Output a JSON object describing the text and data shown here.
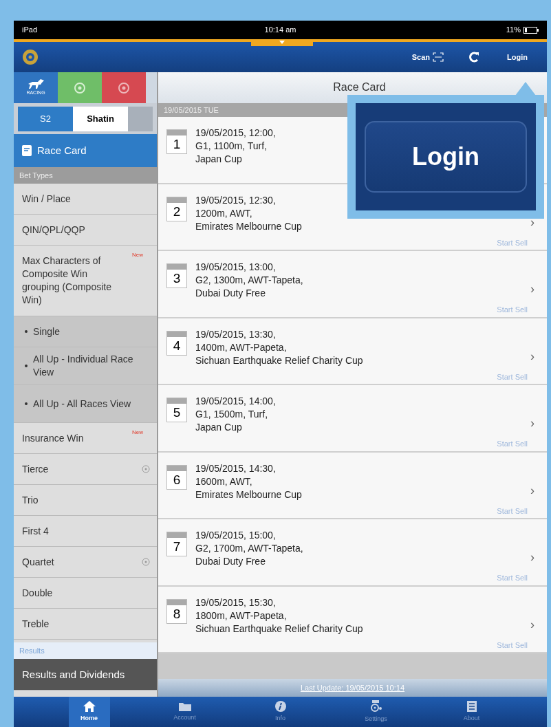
{
  "status_bar": {
    "carrier": "iPad",
    "time": "10:14 am",
    "battery": "11%"
  },
  "header": {
    "scan": "Scan",
    "login": "Login"
  },
  "sport_tabs": [
    {
      "kind": "racing",
      "label": "RACING",
      "selected": true
    },
    {
      "kind": "football",
      "selected": false
    },
    {
      "kind": "lottery",
      "selected": false
    }
  ],
  "venue_tabs": [
    {
      "label": "S2",
      "selected": true
    },
    {
      "label": "Shatin",
      "selected": false
    }
  ],
  "sidebar": {
    "race_card": {
      "label": "Race Card",
      "selected": true
    },
    "sections": [
      {
        "title": "Bet Types",
        "items": [
          {
            "kind": "item",
            "label": "Win / Place"
          },
          {
            "kind": "item",
            "label": "QIN/QPL/QQP"
          },
          {
            "kind": "item",
            "label": "Max Characters of Composite Win grouping (Composite Win)",
            "badge": "New"
          },
          {
            "kind": "sub",
            "label": "Single"
          },
          {
            "kind": "sub",
            "label": "All Up - Individual Race View"
          },
          {
            "kind": "sub",
            "label": "All Up - All Races View"
          },
          {
            "kind": "item",
            "label": "Insurance Win",
            "badge": "New"
          },
          {
            "kind": "item",
            "label": "Tierce",
            "expandable": true
          },
          {
            "kind": "item",
            "label": "Trio"
          },
          {
            "kind": "item",
            "label": "First 4"
          },
          {
            "kind": "item",
            "label": "Quartet",
            "expandable": true
          },
          {
            "kind": "item",
            "label": "Double"
          },
          {
            "kind": "item",
            "label": "Treble"
          }
        ]
      },
      {
        "title": "Results",
        "items": [
          {
            "kind": "dark",
            "label": "Results and Dividends"
          }
        ]
      }
    ]
  },
  "content": {
    "title": "Race Card",
    "date": "19/05/2015 TUE",
    "races": [
      {
        "number": "1",
        "lines": [
          "19/05/2015, 12:00,",
          "G1, 1100m, Turf,",
          "Japan Cup"
        ]
      },
      {
        "number": "2",
        "lines": [
          "19/05/2015, 12:30,",
          "1200m, AWT,",
          "Emirates Melbourne Cup"
        ],
        "chevron": "›",
        "start_sell": "Start Sell"
      },
      {
        "number": "3",
        "lines": [
          "19/05/2015, 13:00,",
          "G2, 1300m, AWT-Tapeta,",
          "Dubai Duty Free"
        ],
        "chevron": "›",
        "start_sell": "Start Sell"
      },
      {
        "number": "4",
        "lines": [
          "19/05/2015, 13:30,",
          "1400m, AWT-Papeta,",
          "Sichuan Earthquake Relief Charity Cup"
        ],
        "chevron": "›",
        "start_sell": "Start Sell"
      },
      {
        "number": "5",
        "lines": [
          "19/05/2015, 14:00,",
          "G1, 1500m, Turf,",
          "Japan Cup"
        ],
        "chevron": "›",
        "start_sell": "Start Sell"
      },
      {
        "number": "6",
        "lines": [
          "19/05/2015, 14:30,",
          "1600m, AWT,",
          "Emirates Melbourne Cup"
        ],
        "chevron": "›",
        "start_sell": "Start Sell"
      },
      {
        "number": "7",
        "lines": [
          "19/05/2015, 15:00,",
          "G2, 1700m, AWT-Tapeta,",
          "Dubai Duty Free"
        ],
        "chevron": "›",
        "start_sell": "Start Sell"
      },
      {
        "number": "8",
        "lines": [
          "19/05/2015, 15:30,",
          "1800m, AWT-Papeta,",
          "Sichuan Earthquake Relief Charity Cup"
        ],
        "chevron": "›",
        "start_sell": "Start Sell"
      }
    ],
    "last_update": "Last Update: 19/05/2015 10:14"
  },
  "tab_bar": [
    {
      "kind": "home",
      "label": "Home",
      "selected": true
    },
    {
      "kind": "account",
      "label": "Account",
      "selected": false
    },
    {
      "kind": "info",
      "label": "Info",
      "selected": false
    },
    {
      "kind": "settings",
      "label": "Settings",
      "selected": false
    },
    {
      "kind": "about",
      "label": "About",
      "selected": false
    }
  ],
  "callout": {
    "button": "Login"
  }
}
